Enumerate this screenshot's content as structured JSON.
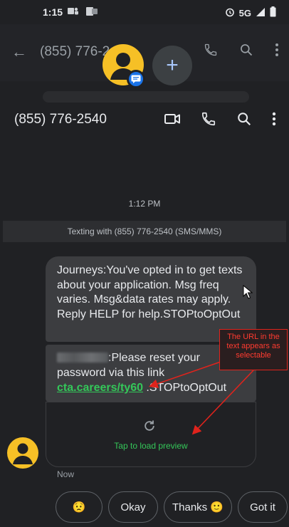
{
  "status_bar": {
    "time": "1:15",
    "network": "5G"
  },
  "background_header": {
    "title": "(855) 776-2"
  },
  "header": {
    "title": "(855) 776-2540"
  },
  "conversation": {
    "time_label": "1:12 PM",
    "texting_banner": "Texting with (855) 776-2540 (SMS/MMS)",
    "message_1": "Journeys:You've opted in to get texts about your application. Msg freq varies. Msg&data rates may apply. Reply HELP for help.STOPtoOptOut",
    "message_2": {
      "text_after_name": ":Please reset your password via this link",
      "link": "cta.careers/ty60",
      "trailing": " .STOPtoOptOut"
    },
    "preview_label": "Tap to load preview",
    "now_label": "Now"
  },
  "annotation": {
    "text": "The URL in the text appears as selectable",
    "color": "#e0231c"
  },
  "smart_replies": {
    "emoji": "😟",
    "okay": "Okay",
    "thanks": "Thanks 🙂",
    "got_it": "Got it"
  },
  "colors": {
    "background": "#202124",
    "bubble": "#3c3d40",
    "link": "#34c759",
    "avatar": "#f6c026",
    "badge": "#1a73e8"
  }
}
